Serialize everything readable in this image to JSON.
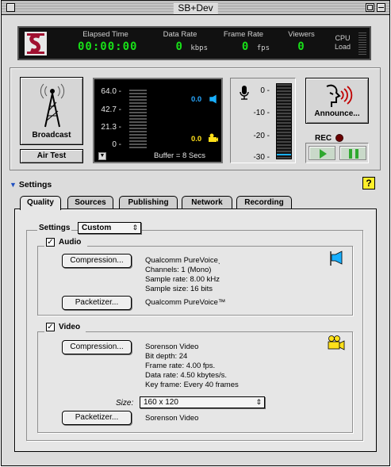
{
  "window": {
    "title": "SB+Dev"
  },
  "stats": {
    "elapsed": {
      "label": "Elapsed Time",
      "value": "00:00:00"
    },
    "data_rate": {
      "label": "Data Rate",
      "value": "0",
      "unit": "kbps"
    },
    "frame_rate": {
      "label": "Frame Rate",
      "value": "0",
      "unit": "fps"
    },
    "viewers": {
      "label": "Viewers",
      "value": "0"
    },
    "cpu_load": {
      "label_1": "CPU",
      "label_2": "Load"
    }
  },
  "broadcast": {
    "button_label": "Broadcast",
    "air_test_label": "Air Test"
  },
  "video_meter": {
    "ticks": [
      "64.0 -",
      "42.7 -",
      "21.3 -",
      "0 -"
    ],
    "audio_value": "0.0",
    "video_value": "0.0",
    "buffer_text": "Buffer = 8 Secs"
  },
  "audio_meter": {
    "ticks": [
      "0 -",
      "-10 -",
      "-20 -",
      "-30 -"
    ]
  },
  "announce": {
    "button_label": "Announce...",
    "rec_label": "REC"
  },
  "settings": {
    "header": "Settings",
    "help_label": "?",
    "tabs": [
      {
        "label": "Quality",
        "active": true
      },
      {
        "label": "Sources",
        "active": false
      },
      {
        "label": "Publishing",
        "active": false
      },
      {
        "label": "Network",
        "active": false
      },
      {
        "label": "Recording",
        "active": false
      }
    ],
    "preset_label": "Settings",
    "preset_value": "Custom",
    "audio": {
      "label": "Audio",
      "checked": true,
      "compression_button": "Compression...",
      "compression_info": [
        "Qualcomm PureVoiceˎ",
        "Channels: 1 (Mono)",
        "Sample rate: 8.00 kHz",
        "Sample size: 16 bits"
      ],
      "packetizer_button": "Packetizer...",
      "packetizer_info": "Qualcomm PureVoice™"
    },
    "video": {
      "label": "Video",
      "checked": true,
      "compression_button": "Compression...",
      "compression_info": [
        "Sorenson Video",
        "Bit depth: 24",
        "Frame rate: 4.00 fps.",
        "Data rate: 4.50 kbytes/s.",
        "Key frame: Every 40 frames"
      ],
      "size_label": "Size:",
      "size_value": "160 x 120",
      "packetizer_button": "Packetizer...",
      "packetizer_info": "Sorenson Video"
    }
  },
  "colors": {
    "lcd_green": "#18e018",
    "meter_blue": "#29a8ff",
    "help_yellow": "#ffef2a"
  }
}
